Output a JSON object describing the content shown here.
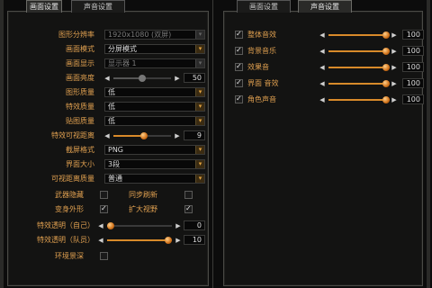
{
  "left_tabs": [
    {
      "label": "画面设置",
      "active": true
    },
    {
      "label": "声音设置",
      "active": false
    }
  ],
  "right_tabs": [
    {
      "label": "画面设置",
      "active": false
    },
    {
      "label": "声音设置",
      "active": true
    }
  ],
  "graphics": {
    "resolution": {
      "label": "图形分辨率",
      "value": "1920x1080 (双屏)"
    },
    "display_mode": {
      "label": "画面模式",
      "value": "分屏模式"
    },
    "display_select": {
      "label": "画面显示",
      "value": "显示器 1"
    },
    "brightness": {
      "label": "画面亮度",
      "value": "50"
    },
    "graphics_quality": {
      "label": "图形质量",
      "value": "低"
    },
    "effects_quality": {
      "label": "特效质量",
      "value": "低"
    },
    "texture_quality": {
      "label": "贴图质量",
      "value": "低"
    },
    "effect_distance": {
      "label": "特效可视距离",
      "value": "9"
    },
    "screenshot_format": {
      "label": "截屏格式",
      "value": "PNG"
    },
    "ui_size": {
      "label": "界面大小",
      "value": "3段"
    },
    "view_distance_quality": {
      "label": "可视距离质量",
      "value": "普通"
    },
    "weapon_hide": {
      "label": "武器隐藏",
      "checked": false
    },
    "sync_refresh": {
      "label": "同步刷新",
      "checked": false
    },
    "transform": {
      "label": "变身外形",
      "checked": true
    },
    "wide_view": {
      "label": "扩大视野",
      "checked": true
    },
    "effect_opacity_self": {
      "label": "特效透明（自己）",
      "value": "0"
    },
    "effect_opacity_party": {
      "label": "特效透明（队员）",
      "value": "10"
    },
    "env_depth": {
      "label": "环境景深",
      "checked": false
    }
  },
  "sound": {
    "items": [
      {
        "label": "整体音效",
        "value": "100",
        "checked": true
      },
      {
        "label": "背景音乐",
        "value": "100",
        "checked": true
      },
      {
        "label": "效果音",
        "value": "100",
        "checked": true
      },
      {
        "label": "界面 音效",
        "value": "100",
        "checked": true
      },
      {
        "label": "角色声音",
        "value": "100",
        "checked": true
      }
    ]
  },
  "icons": {
    "dropdown_arrow": "▾",
    "slider_left": "◀",
    "slider_right": "▶",
    "slider_left_icon": "speaker-low-icon",
    "slider_right_icon": "speaker-high-icon"
  },
  "colors": {
    "label": "#e0a050",
    "accent": "#d88a2a",
    "panel_bg": "#131312"
  }
}
